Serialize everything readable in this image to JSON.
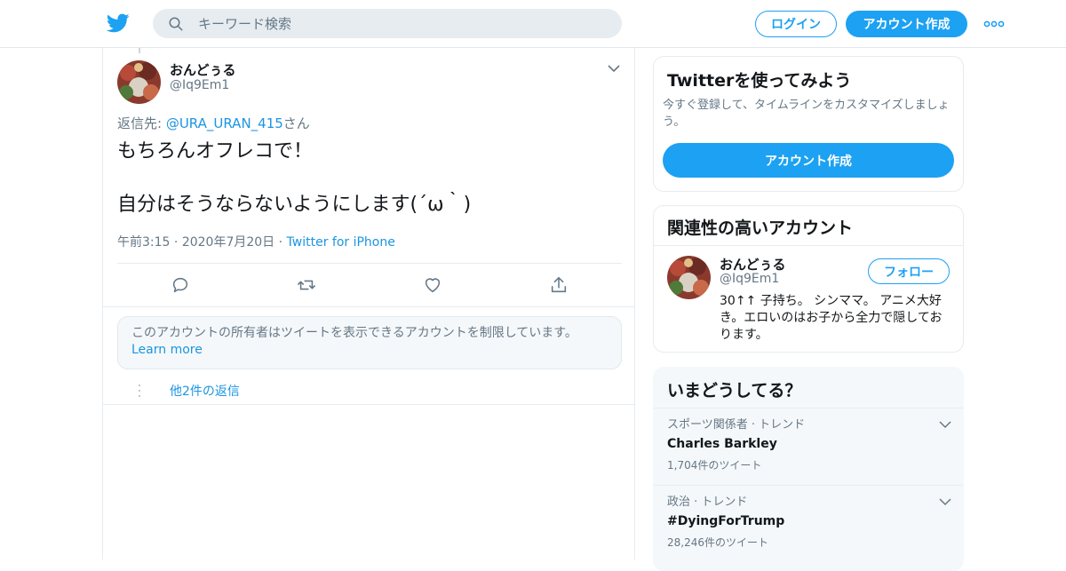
{
  "header": {
    "search_placeholder": "キーワード検索",
    "login_label": "ログイン",
    "signup_label": "アカウント作成"
  },
  "tweet": {
    "author_name": "おんどぅる",
    "author_handle": "@Iq9Em1",
    "reply_prefix": "返信先: ",
    "reply_mention": "@URA_URAN_415",
    "reply_suffix": "さん",
    "text": "もちろんオフレコで！\n\n自分はそうならないようにします(´ω｀)",
    "time": "午前3:15",
    "date": "2020年7月20日",
    "source": "Twitter for iPhone",
    "notice_text": "このアカウントの所有者はツイートを表示できるアカウントを制限しています。",
    "notice_link": "Learn more",
    "more_replies": "他2件の返信"
  },
  "signup_card": {
    "title": "Twitterを使ってみよう",
    "description": "今すぐ登録して、タイムラインをカスタマイズしましょう。",
    "button": "アカウント作成"
  },
  "related_card": {
    "title": "関連性の高いアカウント",
    "name": "おんどぅる",
    "handle": "@Iq9Em1",
    "follow_label": "フォロー",
    "bio": "30↑↑ 子持ち。 シンママ。 アニメ大好き。エロいのはお子から全力で隠しております。"
  },
  "trends_card": {
    "title": "いまどうしてる？",
    "items": [
      {
        "category": "スポーツ関係者 · トレンド",
        "name": "Charles Barkley",
        "count": "1,704件のツイート"
      },
      {
        "category": "政治 · トレンド",
        "name": "#DyingForTrump",
        "count": "28,246件のツイート"
      }
    ]
  },
  "colors": {
    "brand_blue": "#1da1f2",
    "link_blue": "#1b95e0",
    "muted": "#657786"
  }
}
